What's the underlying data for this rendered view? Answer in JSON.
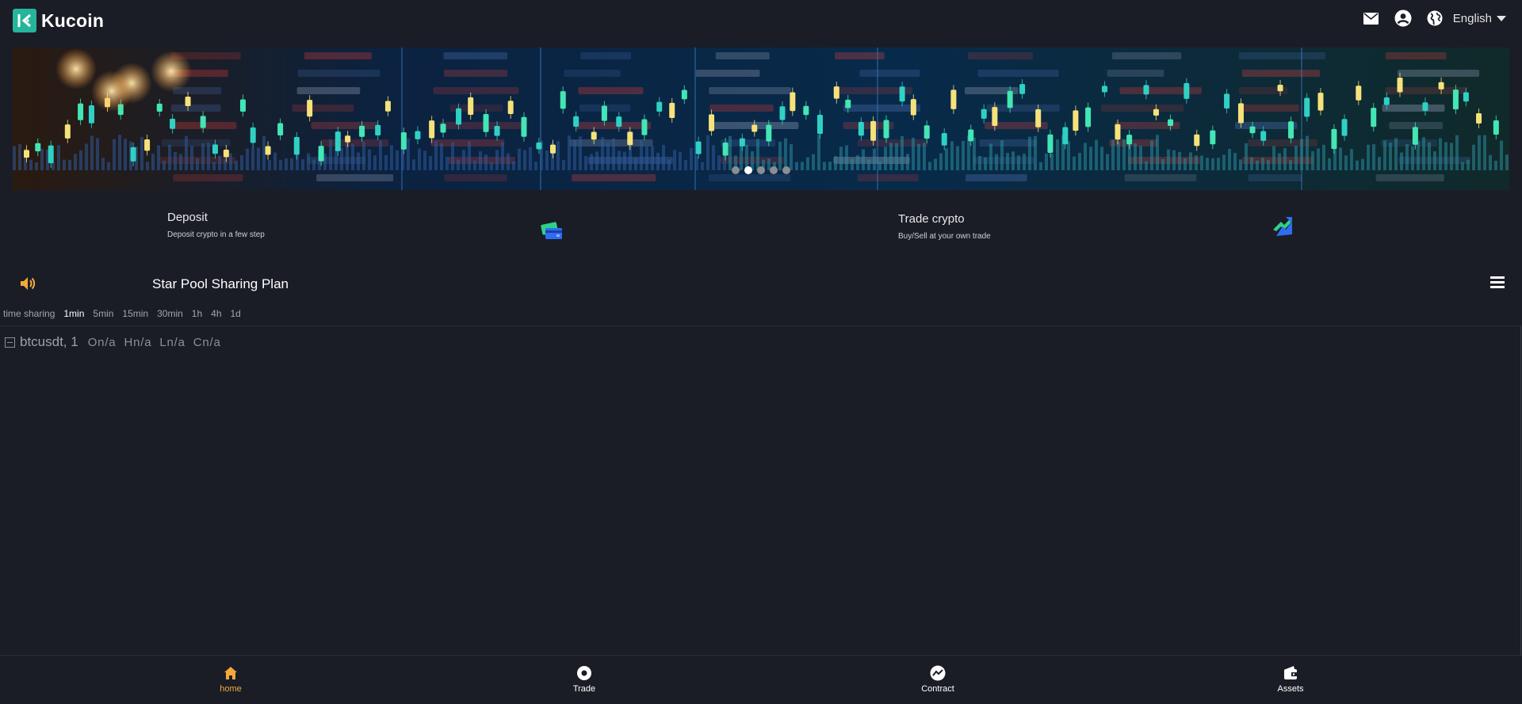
{
  "header": {
    "brand": "Kucoin",
    "icons": [
      "mail-icon",
      "user-icon",
      "globe-icon"
    ],
    "language": "English"
  },
  "banner": {
    "slides": 5,
    "active_slide": 2
  },
  "quick_actions": [
    {
      "title": "Deposit",
      "subtitle": "Deposit crypto in a few step",
      "icon": "card-icon"
    },
    {
      "title": "Trade crypto",
      "subtitle": "Buy/Sell at your own trade",
      "icon": "exchange-icon"
    }
  ],
  "notice": {
    "icon": "speaker-icon",
    "text": "Star Pool Sharing Plan"
  },
  "intervals": {
    "items": [
      "time sharing",
      "1min",
      "5min",
      "15min",
      "30min",
      "1h",
      "4h",
      "1d"
    ],
    "active": "1min"
  },
  "chart_legend": {
    "symbol": "btcusdt, 1",
    "open": "On/a",
    "high": "Hn/a",
    "low": "Ln/a",
    "close": "Cn/a"
  },
  "bottom_nav": {
    "items": [
      {
        "label": "home",
        "icon": "home-icon"
      },
      {
        "label": "Trade",
        "icon": "trade-icon"
      },
      {
        "label": "Contract",
        "icon": "contract-icon"
      },
      {
        "label": "Assets",
        "icon": "wallet-icon"
      }
    ],
    "active": "home"
  },
  "colors": {
    "background": "#1b1d26",
    "brand": "#25b59a",
    "accent_active": "#f2a93b",
    "banner_base": "#061427"
  }
}
